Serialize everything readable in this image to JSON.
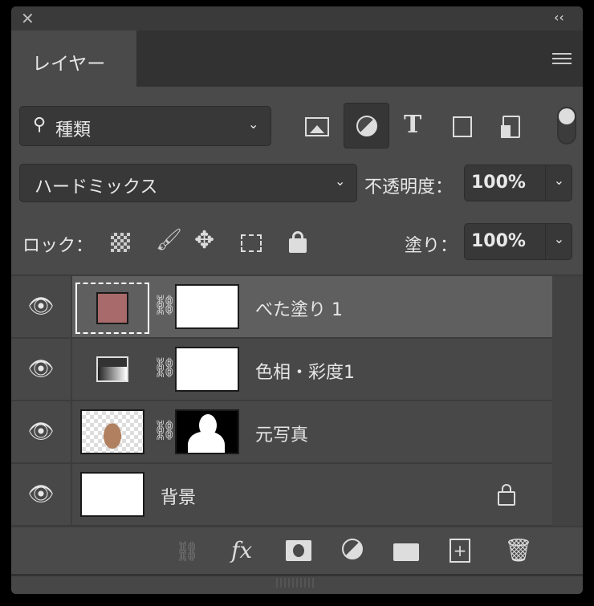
{
  "panel": {
    "close_icon": "close-icon",
    "collapse_icon": "double-chevron-left-icon",
    "tab_label": "レイヤー",
    "menu_icon": "hamburger-menu-icon"
  },
  "filter": {
    "kind_label": "種類",
    "icons": [
      "image-filter-icon",
      "adjustment-filter-icon",
      "type-filter-icon",
      "shape-filter-icon",
      "smart-object-filter-icon"
    ],
    "selected": "adjustment-filter-icon"
  },
  "blend": {
    "mode": "ハードミックス",
    "opacity_label": "不透明度：",
    "opacity_value": "100%"
  },
  "lock": {
    "label": "ロック：",
    "fill_label": "塗り：",
    "fill_value": "100%"
  },
  "layers": [
    {
      "name": "べた塗り 1",
      "fill_color": "#a86a6a",
      "selected": true
    },
    {
      "name": "色相・彩度1"
    },
    {
      "name": "元写真"
    },
    {
      "name": "背景",
      "locked": true
    }
  ],
  "footer_icons": [
    "link-layers-icon",
    "fx-icon",
    "add-mask-icon",
    "new-adjustment-icon",
    "new-group-icon",
    "new-layer-icon",
    "delete-icon"
  ],
  "footer": {
    "fx": "fx"
  }
}
